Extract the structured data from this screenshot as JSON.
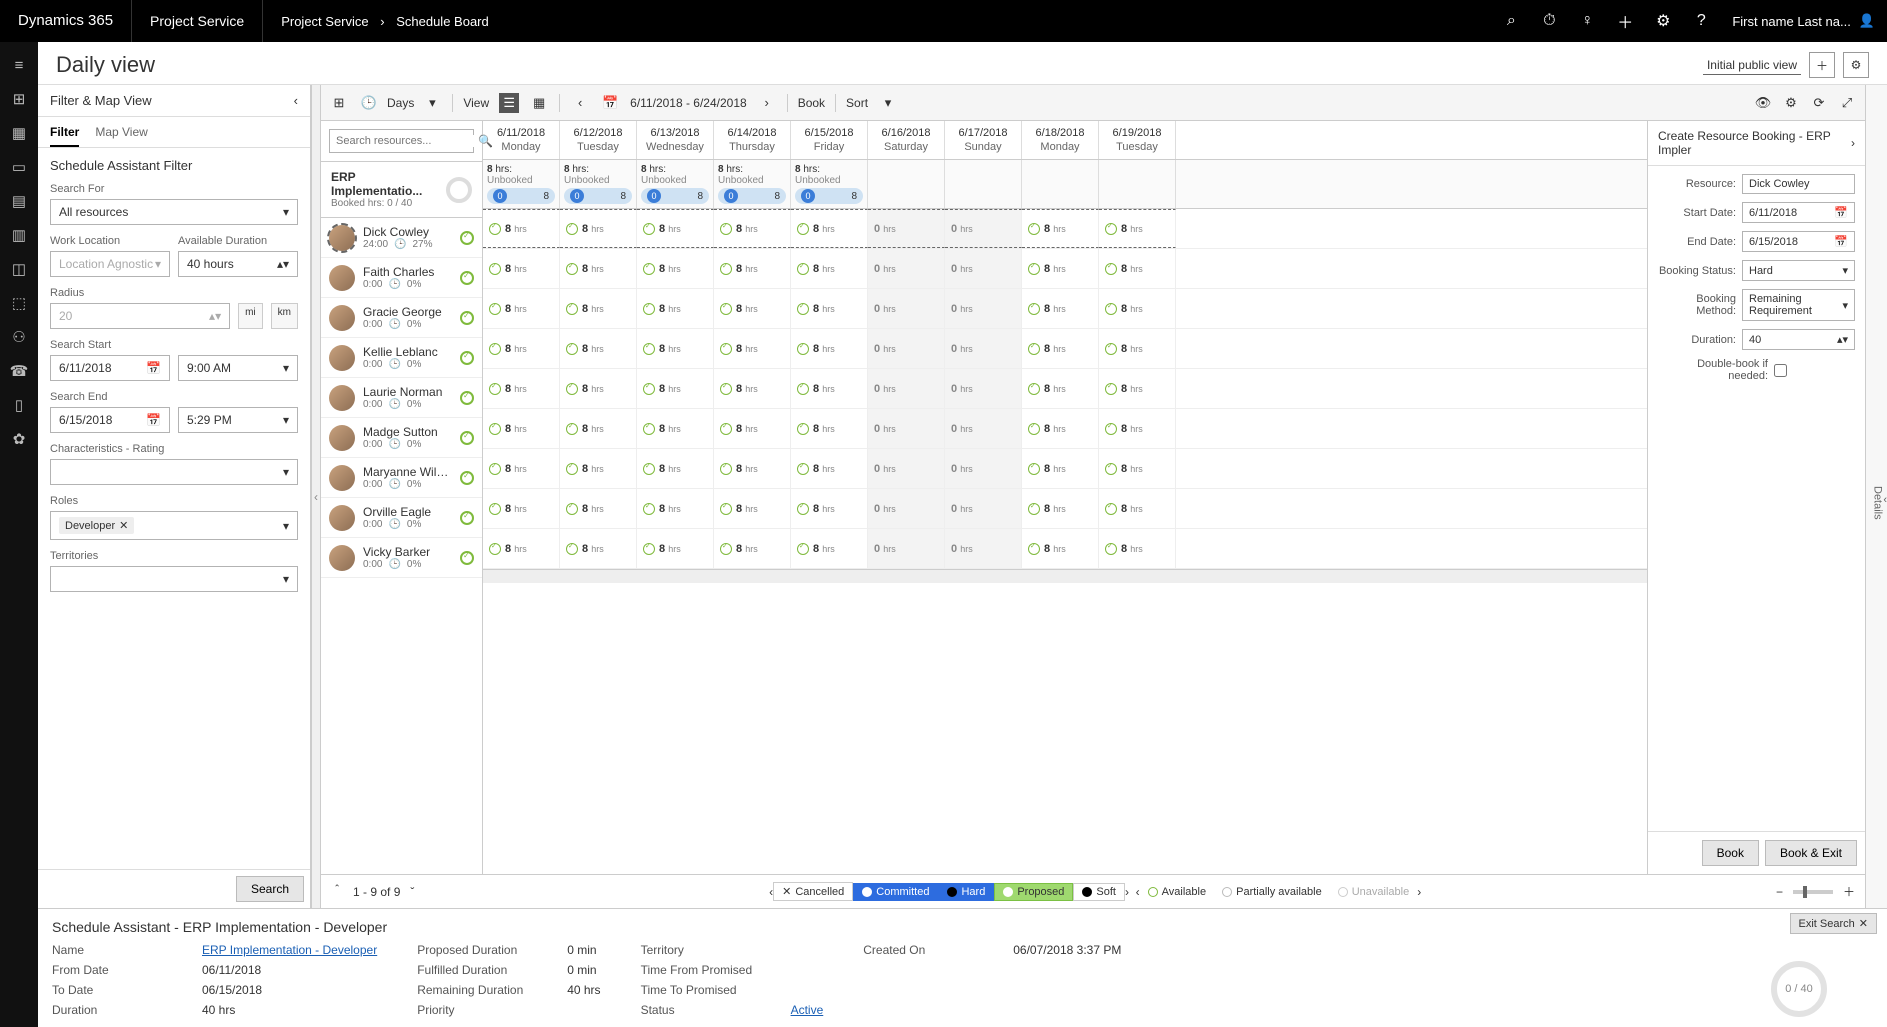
{
  "topbar": {
    "brand": "Dynamics 365",
    "app": "Project Service",
    "crumb1": "Project Service",
    "crumb2": "Schedule Board",
    "user": "First name Last na..."
  },
  "title": "Daily view",
  "viewname": "Initial public view",
  "filterPanel": {
    "heading": "Filter & Map View",
    "tab_filter": "Filter",
    "tab_map": "Map View",
    "sa_title": "Schedule Assistant Filter",
    "searchFor": {
      "label": "Search For",
      "value": "All resources"
    },
    "workLocation": {
      "label": "Work Location",
      "value": "Location Agnostic"
    },
    "availDuration": {
      "label": "Available Duration",
      "value": "40 hours"
    },
    "radius": {
      "label": "Radius",
      "value": "20",
      "unit_mi": "mi",
      "unit_km": "km"
    },
    "searchStart": {
      "label": "Search Start",
      "date": "6/11/2018",
      "time": "9:00 AM"
    },
    "searchEnd": {
      "label": "Search End",
      "date": "6/15/2018",
      "time": "5:29 PM"
    },
    "characteristics": {
      "label": "Characteristics - Rating"
    },
    "roles": {
      "label": "Roles",
      "tag": "Developer"
    },
    "territories": {
      "label": "Territories"
    },
    "searchBtn": "Search"
  },
  "toolbar": {
    "days": "Days",
    "view": "View",
    "range": "6/11/2018 - 6/24/2018",
    "book": "Book",
    "sort": "Sort"
  },
  "searchPlaceholder": "Search resources...",
  "project": {
    "name": "ERP Implementatio...",
    "booked": "Booked hrs: 0 / 40"
  },
  "dates": [
    {
      "date": "6/11/2018",
      "day": "Monday",
      "we": false
    },
    {
      "date": "6/12/2018",
      "day": "Tuesday",
      "we": false
    },
    {
      "date": "6/13/2018",
      "day": "Wednesday",
      "we": false
    },
    {
      "date": "6/14/2018",
      "day": "Thursday",
      "we": false
    },
    {
      "date": "6/15/2018",
      "day": "Friday",
      "we": false
    },
    {
      "date": "6/16/2018",
      "day": "Saturday",
      "we": true
    },
    {
      "date": "6/17/2018",
      "day": "Sunday",
      "we": true
    },
    {
      "date": "6/18/2018",
      "day": "Monday",
      "we": false
    },
    {
      "date": "6/19/2018",
      "day": "Tuesday",
      "we": false
    }
  ],
  "summary": {
    "hrs": "8",
    "hrsLabel": "hrs:",
    "unbooked": "Unbooked",
    "pill_badge": "0",
    "pill_right": "8"
  },
  "resources": [
    {
      "name": "Dick Cowley",
      "hours": "24:00",
      "pct": "27%",
      "sel": true
    },
    {
      "name": "Faith Charles",
      "hours": "0:00",
      "pct": "0%",
      "sel": false
    },
    {
      "name": "Gracie George",
      "hours": "0:00",
      "pct": "0%",
      "sel": false
    },
    {
      "name": "Kellie Leblanc",
      "hours": "0:00",
      "pct": "0%",
      "sel": false
    },
    {
      "name": "Laurie Norman",
      "hours": "0:00",
      "pct": "0%",
      "sel": false
    },
    {
      "name": "Madge Sutton",
      "hours": "0:00",
      "pct": "0%",
      "sel": false
    },
    {
      "name": "Maryanne Wilcox",
      "hours": "0:00",
      "pct": "0%",
      "sel": false
    },
    {
      "name": "Orville Eagle",
      "hours": "0:00",
      "pct": "0%",
      "sel": false
    },
    {
      "name": "Vicky Barker",
      "hours": "0:00",
      "pct": "0%",
      "sel": false
    }
  ],
  "cellWeekday": {
    "num": "8",
    "suffix": "hrs"
  },
  "cellWeekend": {
    "num": "0",
    "suffix": "hrs"
  },
  "bookPanel": {
    "title": "Create Resource Booking - ERP Impler",
    "resourceL": "Resource:",
    "resource": "Dick Cowley",
    "startL": "Start Date:",
    "start": "6/11/2018",
    "endL": "End Date:",
    "end": "6/15/2018",
    "statusL": "Booking Status:",
    "status": "Hard",
    "methodL": "Booking Method:",
    "method": "Remaining Requirement",
    "durationL": "Duration:",
    "duration": "40",
    "dblL": "Double-book if needed:",
    "bookBtn": "Book",
    "bookExitBtn": "Book & Exit"
  },
  "pager": {
    "range": "1 - 9 of 9",
    "cancelled": "Cancelled",
    "committed": "Committed",
    "hard": "Hard",
    "proposed": "Proposed",
    "soft": "Soft",
    "available": "Available",
    "partial": "Partially available",
    "unavail": "Unavailable"
  },
  "bottom": {
    "title": "Schedule Assistant - ERP Implementation - Developer",
    "exit": "Exit Search",
    "ring": "0 / 40",
    "nameL": "Name",
    "name": "ERP Implementation - Developer",
    "fromL": "From Date",
    "from": "06/11/2018",
    "toL": "To Date",
    "to": "06/15/2018",
    "durL": "Duration",
    "dur": "40 hrs",
    "propL": "Proposed Duration",
    "prop": "0 min",
    "fulL": "Fulfilled Duration",
    "ful": "0 min",
    "remL": "Remaining Duration",
    "rem": "40 hrs",
    "prioL": "Priority",
    "prio": "",
    "terrL": "Territory",
    "terr": "",
    "tfpL": "Time From Promised",
    "tfp": "",
    "ttpL": "Time To Promised",
    "ttp": "",
    "statL": "Status",
    "stat": "Active",
    "createdL": "Created On",
    "created": "06/07/2018 3:37 PM"
  }
}
